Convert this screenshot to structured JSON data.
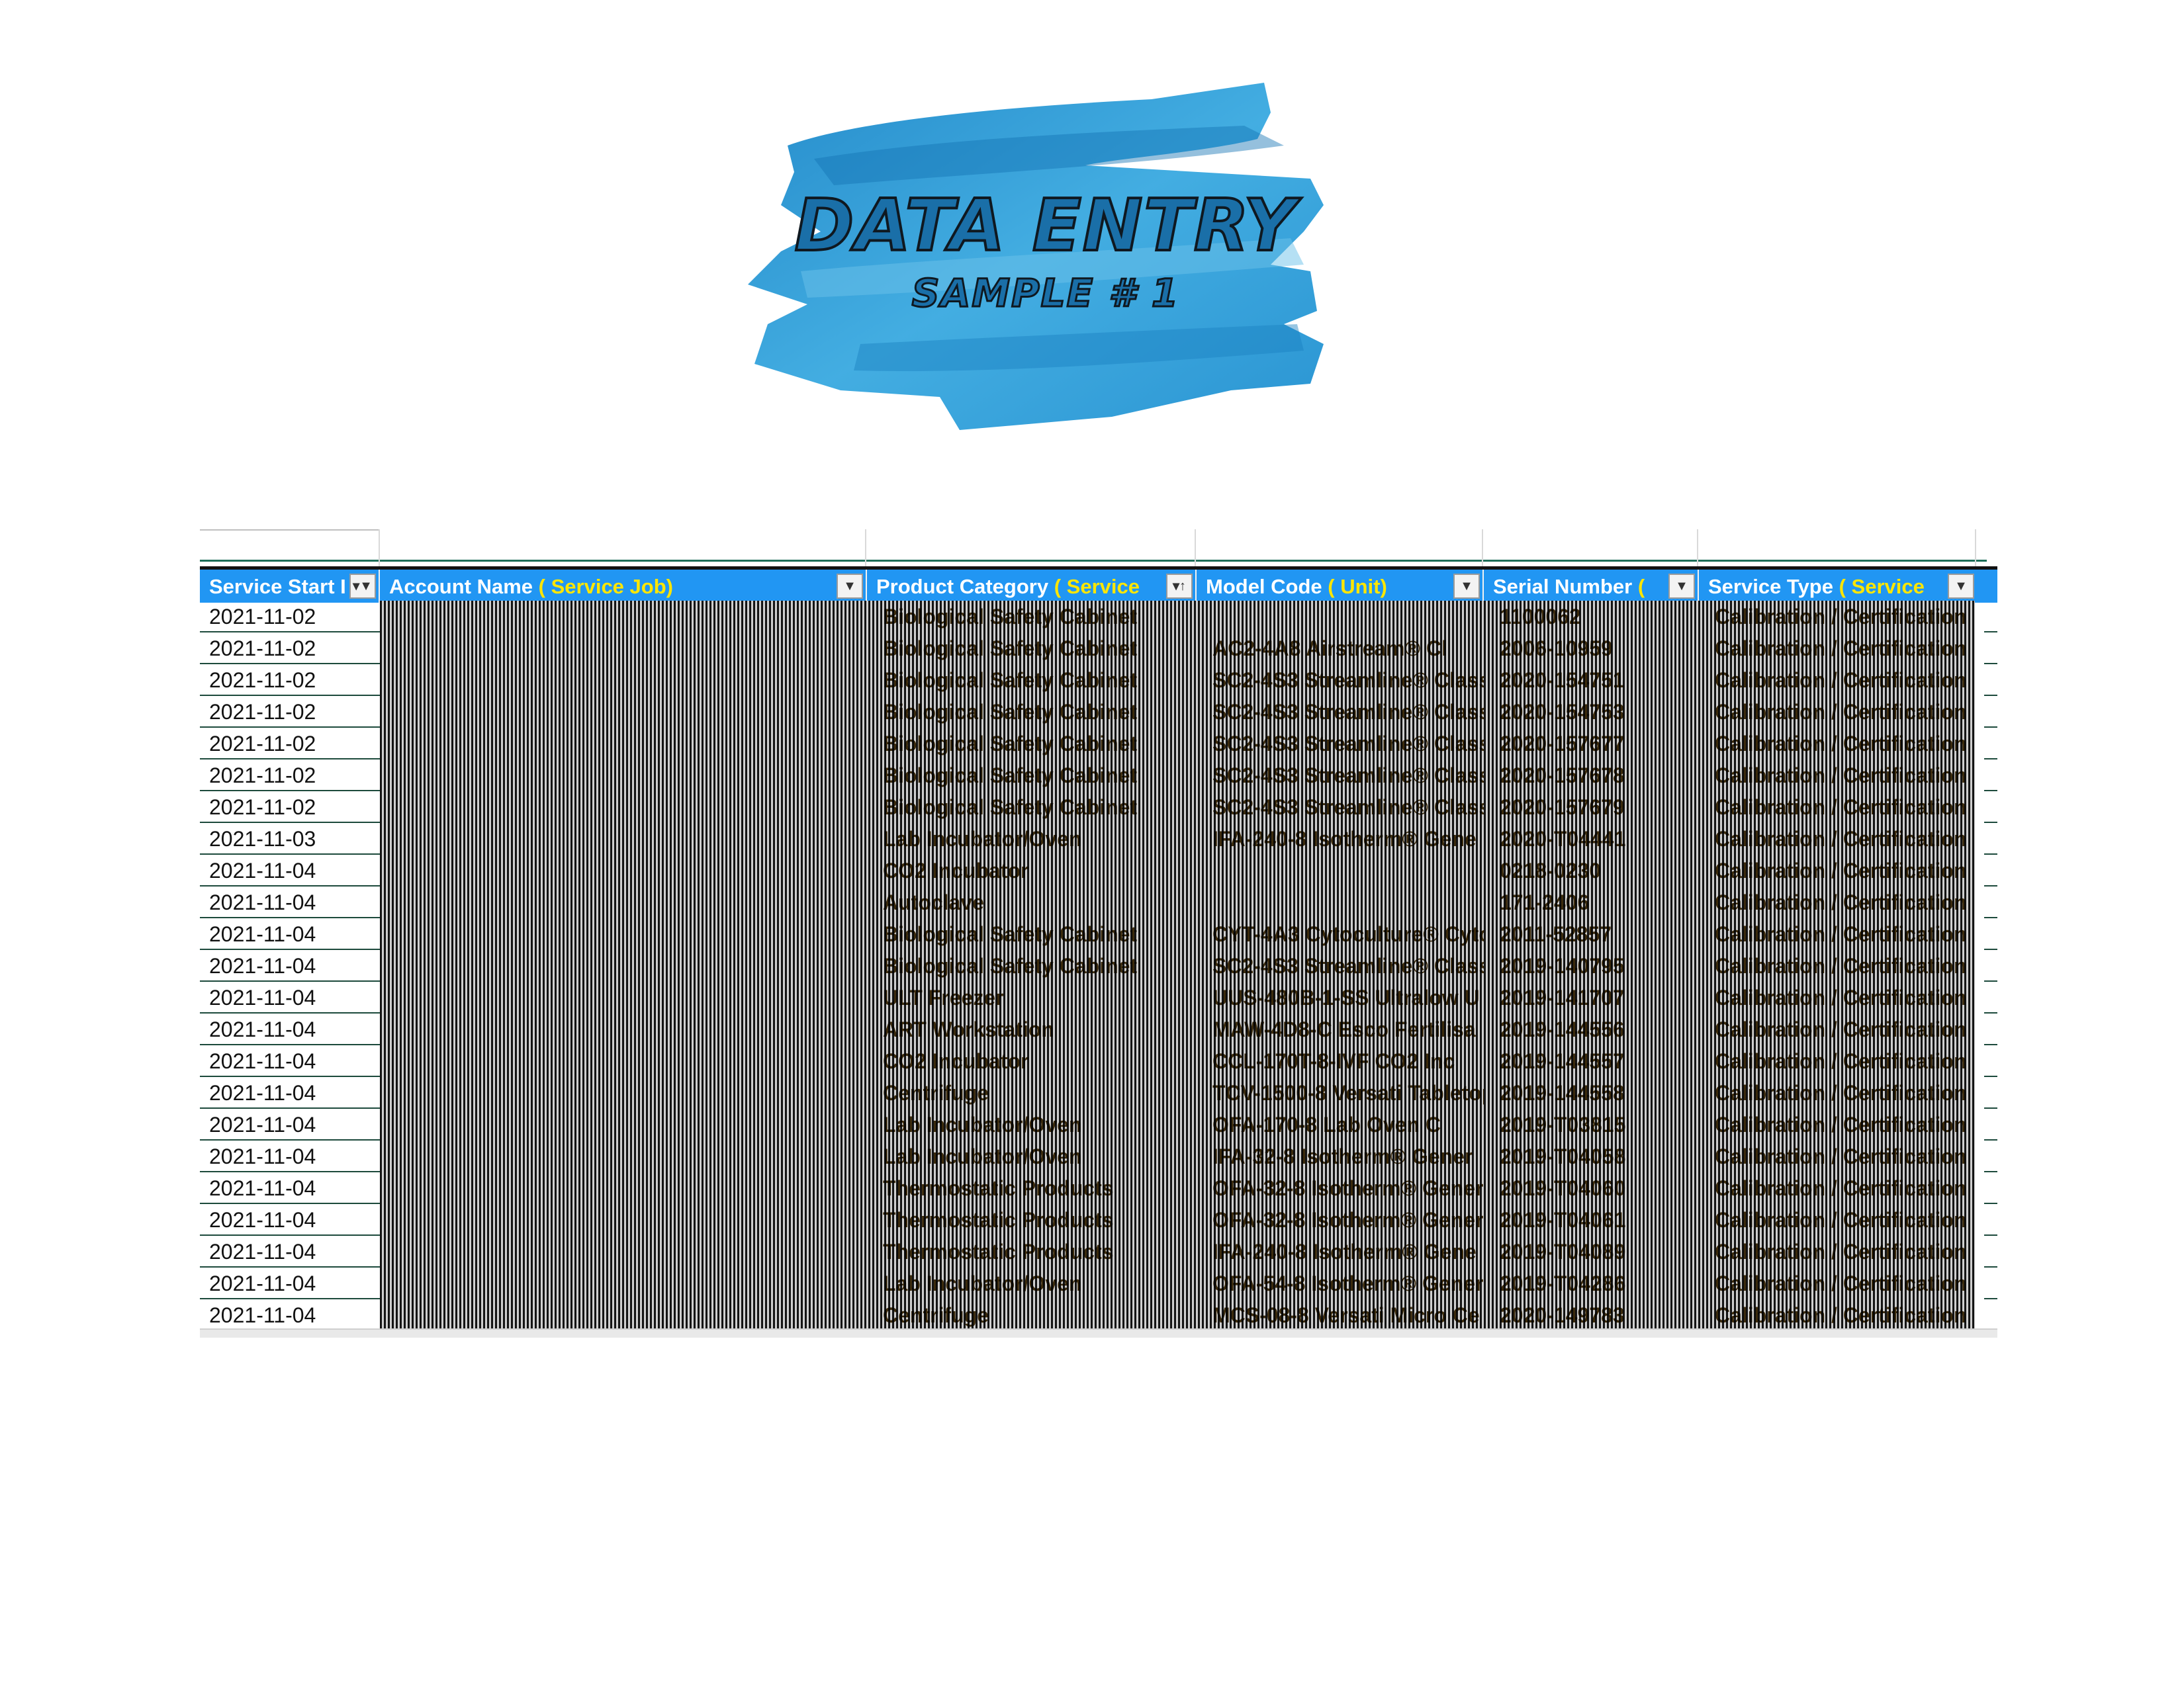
{
  "header": {
    "title": "DATA ENTRY",
    "subtitle": "SAMPLE # 1"
  },
  "colors": {
    "header_bg": "#2196f3",
    "header_accent": "#ffe600",
    "brush": "#2b9bd8"
  },
  "columns": [
    {
      "label": "Service Start I",
      "accent": ""
    },
    {
      "label": "Account Name ",
      "accent": "( Service Job)"
    },
    {
      "label": "Product Category ",
      "accent": "( Service"
    },
    {
      "label": "Model Code ",
      "accent": "( Unit)"
    },
    {
      "label": "Serial Number ",
      "accent": "("
    },
    {
      "label": "Service Type ",
      "accent": "( Service"
    }
  ],
  "rows": [
    {
      "date": "2021-11-02",
      "category": "Biological Safety Cabinet",
      "model": "",
      "serial": "1100062",
      "type": "Calibration / Certification"
    },
    {
      "date": "2021-11-02",
      "category": "Biological Safety Cabinet",
      "model": "AC2-4A8 Airstream® Cl",
      "serial": "2006-10959",
      "type": "Calibration / Certification"
    },
    {
      "date": "2021-11-02",
      "category": "Biological Safety Cabinet",
      "model": "SC2-4S3 Streamline® Class",
      "serial": "2020-154751",
      "type": "Calibration / Certification"
    },
    {
      "date": "2021-11-02",
      "category": "Biological Safety Cabinet",
      "model": "SC2-4S3 Streamline® Class",
      "serial": "2020-154753",
      "type": "Calibration / Certification"
    },
    {
      "date": "2021-11-02",
      "category": "Biological Safety Cabinet",
      "model": "SC2-4S3 Streamline® Class",
      "serial": "2020-157677",
      "type": "Calibration / Certification"
    },
    {
      "date": "2021-11-02",
      "category": "Biological Safety Cabinet",
      "model": "SC2-4S3 Streamline® Class",
      "serial": "2020-157678",
      "type": "Calibration / Certification"
    },
    {
      "date": "2021-11-02",
      "category": "Biological Safety Cabinet",
      "model": "SC2-4S3 Streamline® Class",
      "serial": "2020-157679",
      "type": "Calibration / Certification"
    },
    {
      "date": "2021-11-03",
      "category": "Lab Incubator/Oven",
      "model": "IFA-240-8 Isotherm® Gene",
      "serial": "2020-T04441",
      "type": "Calibration / Certification"
    },
    {
      "date": "2021-11-04",
      "category": "CO2 Incubator",
      "model": "",
      "serial": "0218-0230",
      "type": "Calibration / Certification"
    },
    {
      "date": "2021-11-04",
      "category": "Autoclave",
      "model": "",
      "serial": "171-2406",
      "type": "Calibration / Certification"
    },
    {
      "date": "2021-11-04",
      "category": "Biological Safety Cabinet",
      "model": "CYT-4A3 Cytoculture® Cyto",
      "serial": "2011-52857",
      "type": "Calibration / Certification"
    },
    {
      "date": "2021-11-04",
      "category": "Biological Safety Cabinet",
      "model": "SC2-4S3 Streamline® Class",
      "serial": "2019-140795",
      "type": "Calibration / Certification"
    },
    {
      "date": "2021-11-04",
      "category": "ULT Freezer",
      "model": "UUS-480B-1-SS Ultralow U",
      "serial": "2019-141707",
      "type": "Calibration / Certification"
    },
    {
      "date": "2021-11-04",
      "category": "ART Workstation",
      "model": "MAW-4D8-C Esco Fertilisa",
      "serial": "2019-144556",
      "type": "Calibration / Certification"
    },
    {
      "date": "2021-11-04",
      "category": "CO2 Incubator",
      "model": "CCL-170T-8-IVF CO2 Inc",
      "serial": "2019-144557",
      "type": "Calibration / Certification"
    },
    {
      "date": "2021-11-04",
      "category": "Centrifuge",
      "model": "TCV-1500-8 Versati Tabletop",
      "serial": "2019-144558",
      "type": "Calibration / Certification"
    },
    {
      "date": "2021-11-04",
      "category": "Lab Incubator/Oven",
      "model": "OFA-170-8 Lab Oven C",
      "serial": "2019-T03815",
      "type": "Calibration / Certification"
    },
    {
      "date": "2021-11-04",
      "category": "Lab Incubator/Oven",
      "model": "IFA-32-8 Isotherm® Gener",
      "serial": "2019-T04058",
      "type": "Calibration / Certification"
    },
    {
      "date": "2021-11-04",
      "category": "Thermostatic Products",
      "model": "OFA-32-8 Isotherm® Gener",
      "serial": "2019-T04060",
      "type": "Calibration / Certification"
    },
    {
      "date": "2021-11-04",
      "category": "Thermostatic Products",
      "model": "OFA-32-8 Isotherm® Gener",
      "serial": "2019-T04061",
      "type": "Calibration / Certification"
    },
    {
      "date": "2021-11-04",
      "category": "Thermostatic Products",
      "model": "IFA-240-8 Isotherm® Gene",
      "serial": "2019-T04089",
      "type": "Calibration / Certification"
    },
    {
      "date": "2021-11-04",
      "category": "Lab Incubator/Oven",
      "model": "OFA-54-8 Isotherm® Gener",
      "serial": "2019-T04286",
      "type": "Calibration / Certification"
    },
    {
      "date": "2021-11-04",
      "category": "Centrifuge",
      "model": "MCS-08-8 Versati Micro Ce",
      "serial": "2020-149783",
      "type": "Calibration / Certification"
    }
  ]
}
